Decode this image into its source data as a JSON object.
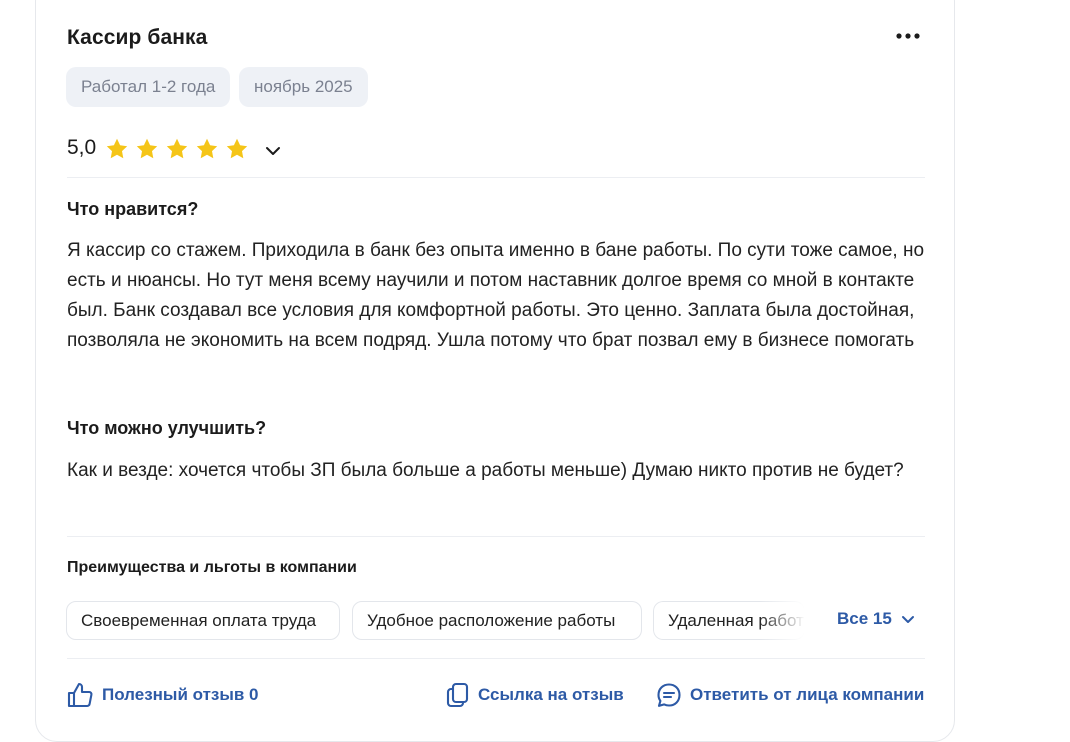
{
  "review": {
    "title": "Кассир банка",
    "tags": [
      "Работал 1-2 года",
      "ноябрь 2025"
    ],
    "rating": {
      "value": "5,0",
      "stars": 5,
      "max": 5
    },
    "sections": [
      {
        "heading": "Что нравится?",
        "text": "Я кассир со стажем. Приходила в банк без опыта именно в бане работы. По сути тоже самое, но есть и нюансы. Но тут меня всему научили и потом наставник долгое время со мной в контакте был. Банк создавал все условия для комфортной работы. Это ценно. Заплата была достойная, позволяла не экономить на всем подряд. Ушла потому что брат позвал ему в бизнесе помогать"
      },
      {
        "heading": "Что можно улучшить?",
        "text": "Как и везде: хочется чтобы ЗП была больше а работы меньше) Думаю никто против не будет?"
      }
    ],
    "benefits": {
      "heading": "Преимущества и льготы в компании",
      "items": [
        "Своевременная оплата труда",
        "Удобное расположение работы",
        "Удаленная работа"
      ],
      "all_label": "Все 15"
    },
    "actions": {
      "helpful": "Полезный отзыв 0",
      "link": "Ссылка на отзыв",
      "reply": "Ответить от лица компании"
    }
  },
  "colors": {
    "accent": "#2d5aa6",
    "star": "#f5c518",
    "chip_bg": "#eef1f6",
    "chip_text": "#7b8190"
  },
  "icons": [
    "more-horizontal-icon",
    "star-icon",
    "chevron-down-icon",
    "thumb-up-icon",
    "copy-link-icon",
    "chat-bubble-icon"
  ]
}
